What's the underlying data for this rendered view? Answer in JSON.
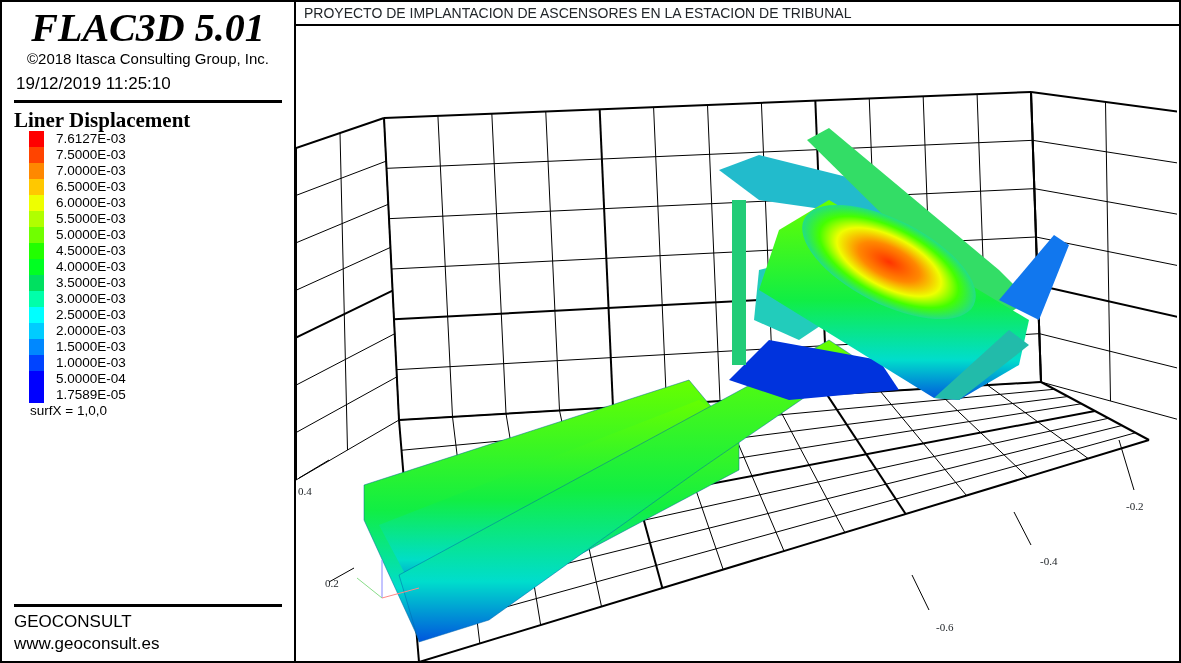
{
  "app_title": "FLAC3D 5.01",
  "copyright": "©2018 Itasca Consulting Group, Inc.",
  "timestamp": "19/12/2019 11:25:10",
  "legend": {
    "title": "Liner Displacement",
    "entries": [
      {
        "label": "7.6127E-03",
        "color": "#ff0000"
      },
      {
        "label": "7.5000E-03",
        "color": "#ff4400"
      },
      {
        "label": "7.0000E-03",
        "color": "#ff8800"
      },
      {
        "label": "6.5000E-03",
        "color": "#ffc800"
      },
      {
        "label": "6.0000E-03",
        "color": "#eeff00"
      },
      {
        "label": "5.5000E-03",
        "color": "#b0ff00"
      },
      {
        "label": "5.0000E-03",
        "color": "#70ff00"
      },
      {
        "label": "4.5000E-03",
        "color": "#22ff00"
      },
      {
        "label": "4.0000E-03",
        "color": "#00ff22"
      },
      {
        "label": "3.5000E-03",
        "color": "#00e060"
      },
      {
        "label": "3.0000E-03",
        "color": "#00ffaa"
      },
      {
        "label": "2.5000E-03",
        "color": "#00ffff"
      },
      {
        "label": "2.0000E-03",
        "color": "#00ccff"
      },
      {
        "label": "1.5000E-03",
        "color": "#0088ff"
      },
      {
        "label": "1.0000E-03",
        "color": "#0044ff"
      },
      {
        "label": "5.0000E-04",
        "color": "#0000ff"
      },
      {
        "label": "1.7589E-05",
        "color": "#0000ff"
      }
    ],
    "note": "surfX = 1,0,0"
  },
  "footer": {
    "company": "GEOCONSULT",
    "website": "www.geoconsult.es"
  },
  "plot_title": "PROYECTO DE IMPLANTACION DE ASCENSORES EN LA ESTACION DE TRIBUNAL",
  "axis_labels": [
    "0.4",
    "0.2",
    "-0.2",
    "-0.4",
    "-0.6"
  ]
}
